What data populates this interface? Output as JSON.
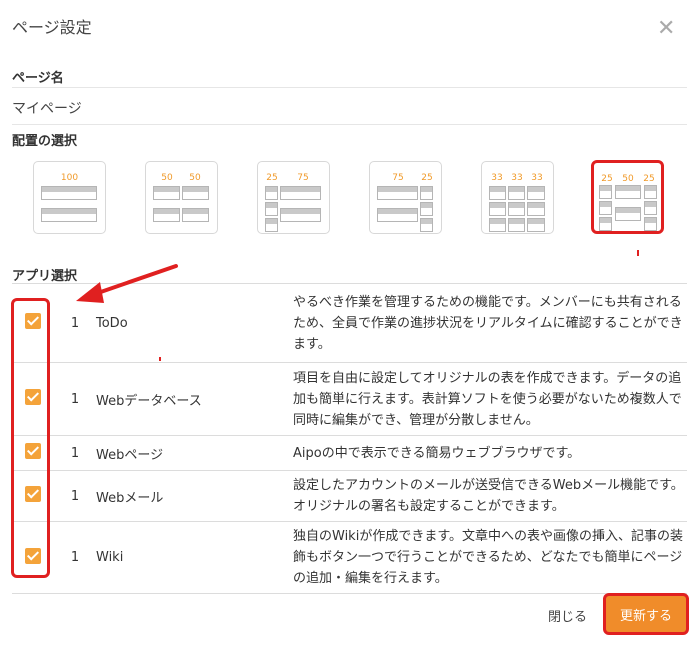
{
  "dialog": {
    "title": "ページ設定",
    "close_icon": "close-icon"
  },
  "page_name": {
    "label": "ページ名",
    "value": "マイページ"
  },
  "layout": {
    "label": "配置の選択",
    "options": [
      {
        "widths": [
          "100"
        ],
        "selected": false
      },
      {
        "widths": [
          "50",
          "50"
        ],
        "selected": false
      },
      {
        "widths": [
          "25",
          "75"
        ],
        "selected": false
      },
      {
        "widths": [
          "75",
          "25"
        ],
        "selected": false
      },
      {
        "widths": [
          "33",
          "33",
          "33"
        ],
        "selected": false
      },
      {
        "widths": [
          "25",
          "50",
          "25"
        ],
        "selected": true
      }
    ]
  },
  "apps": {
    "label": "アプリ選択",
    "rows": [
      {
        "checked": true,
        "count": "1",
        "name": "ToDo",
        "description": "やるべき作業を管理するための機能です。メンバーにも共有されるため、全員で作業の進捗状況をリアルタイムに確認することができます。"
      },
      {
        "checked": true,
        "count": "1",
        "name": "Webデータベース",
        "description": "項目を自由に設定してオリジナルの表を作成できます。データの追加も簡単に行えます。表計算ソフトを使う必要がないため複数人で同時に編集ができ、管理が分散しません。"
      },
      {
        "checked": true,
        "count": "1",
        "name": "Webページ",
        "description": "Aipoの中で表示できる簡易ウェブブラウザです。"
      },
      {
        "checked": true,
        "count": "1",
        "name": "Webメール",
        "description": "設定したアカウントのメールが送受信できるWebメール機能です。オリジナルの署名も設定することができます。"
      },
      {
        "checked": true,
        "count": "1",
        "name": "Wiki",
        "description": "独自のWikiが作成できます。文章中への表や画像の挿入、記事の装飾もボタン一つで行うことができるため、どなたでも簡単にページの追加・編集を行えます。"
      }
    ]
  },
  "footer": {
    "close_label": "閉じる",
    "update_label": "更新する"
  },
  "colors": {
    "accent": "#f08c2a",
    "highlight": "#e02020"
  }
}
